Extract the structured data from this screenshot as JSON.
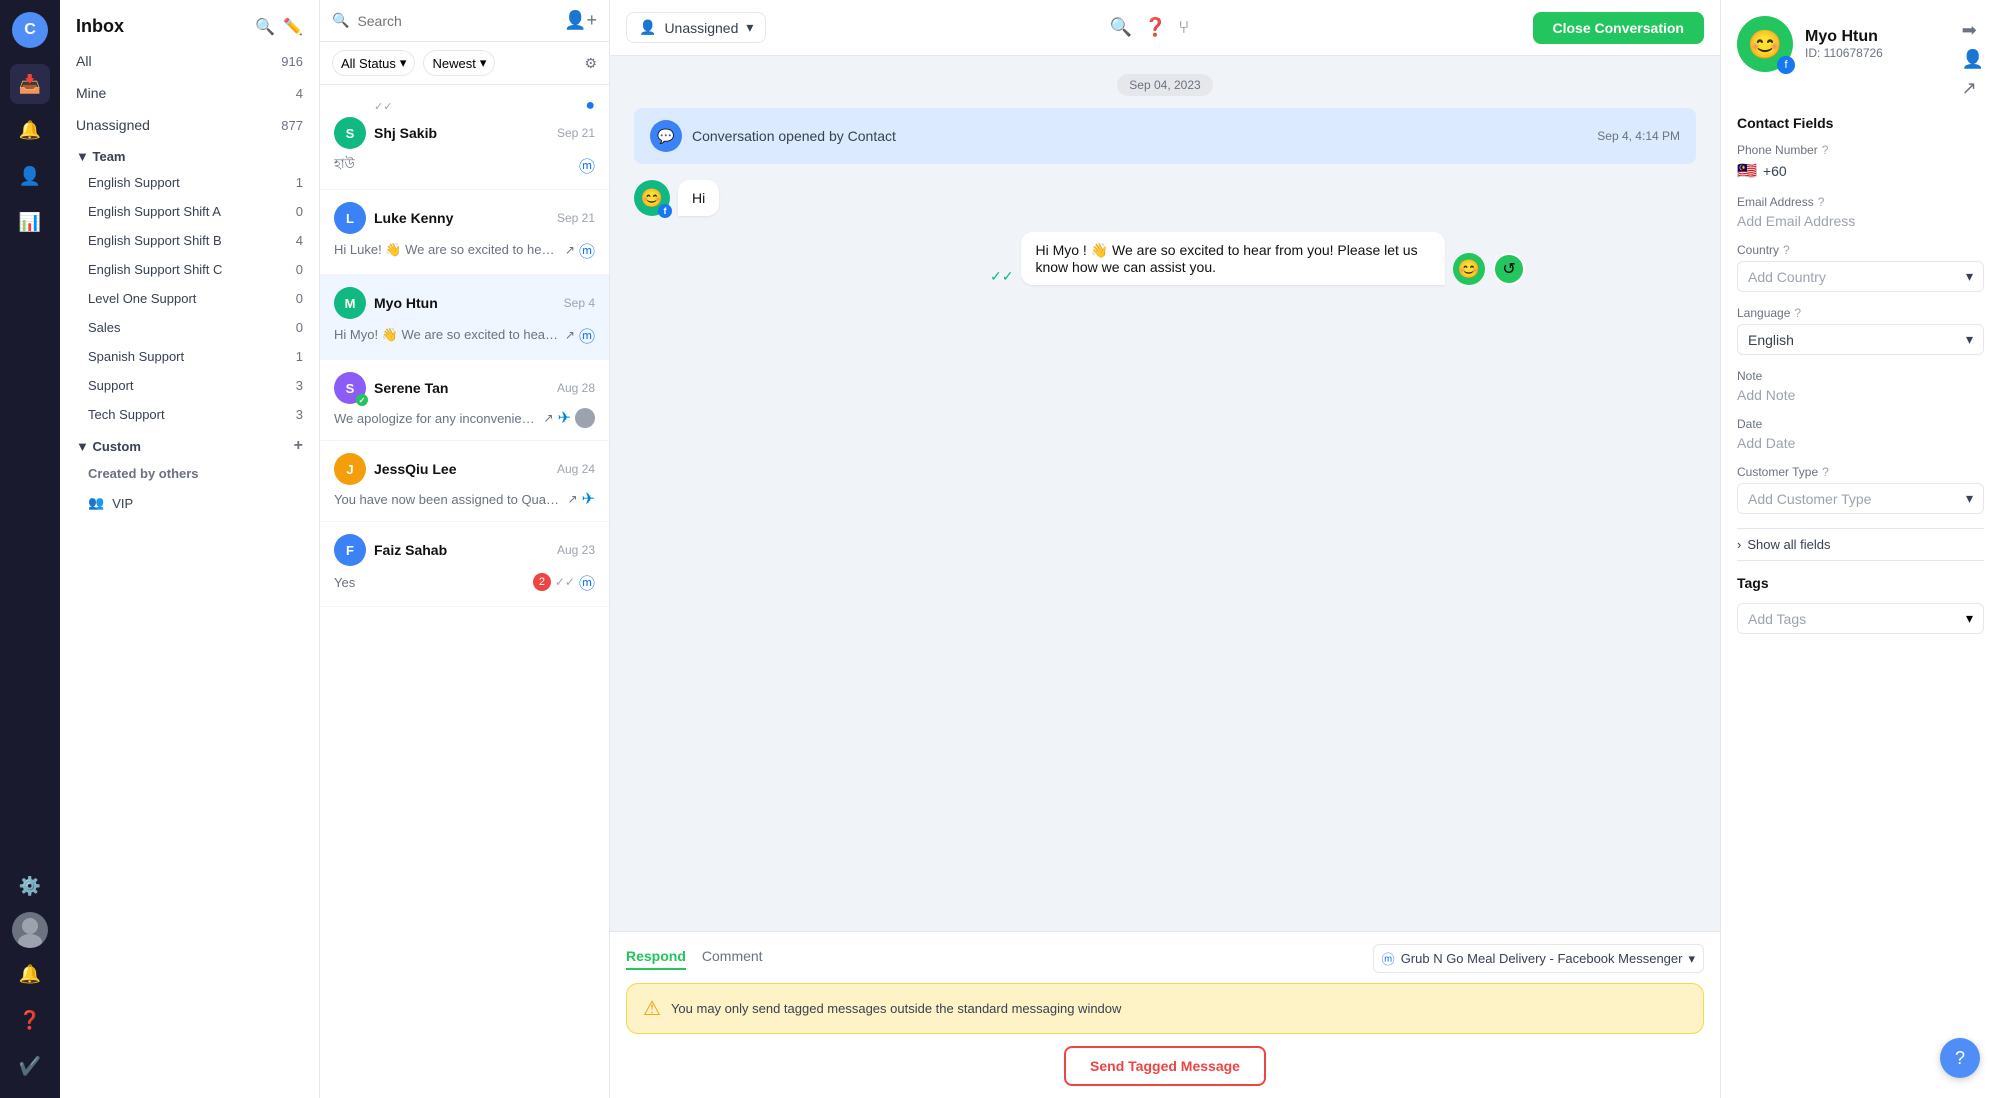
{
  "app": {
    "logo": "C",
    "title": "Inbox"
  },
  "nav": {
    "items": [
      {
        "id": "inbox",
        "icon": "📥",
        "active": true
      },
      {
        "id": "mentions",
        "icon": "🔔"
      },
      {
        "id": "contacts",
        "icon": "👤"
      },
      {
        "id": "reports",
        "icon": "📊"
      },
      {
        "id": "settings",
        "icon": "⚙️"
      }
    ]
  },
  "sidebar": {
    "header": "Inbox",
    "items": [
      {
        "label": "All",
        "count": "916"
      },
      {
        "label": "Mine",
        "count": "4"
      },
      {
        "label": "Unassigned",
        "count": "877"
      }
    ],
    "team_label": "Team",
    "team_items": [
      {
        "label": "English Support",
        "count": "1"
      },
      {
        "label": "English Support Shift A",
        "count": "0"
      },
      {
        "label": "English Support Shift B",
        "count": "4"
      },
      {
        "label": "English Support Shift C",
        "count": "0"
      },
      {
        "label": "Level One Support",
        "count": "0"
      },
      {
        "label": "Sales",
        "count": "0"
      },
      {
        "label": "Spanish Support",
        "count": "1"
      },
      {
        "label": "Support",
        "count": "3"
      },
      {
        "label": "Tech Support",
        "count": "3"
      }
    ],
    "custom_label": "Custom",
    "custom_others_label": "Created by others",
    "custom_items": [
      {
        "label": "VIP",
        "icon": "👥"
      }
    ]
  },
  "conv_list": {
    "search_placeholder": "Search",
    "filter_status": "All Status",
    "filter_sort": "Newest",
    "conversations": [
      {
        "id": 1,
        "sender": "Shj Sakib",
        "avatar_color": "green",
        "avatar_text": "S",
        "date": "Sep 21",
        "preview": "হাউ",
        "channel": "fb",
        "has_tick": true
      },
      {
        "id": 2,
        "sender": "Luke Kenny",
        "avatar_color": "blue",
        "avatar_text": "L",
        "date": "Sep 21",
        "preview": "Hi Luke! 👋 We are so excited to hear from you! Please let us kno...",
        "channel": "fb",
        "has_tick": false,
        "has_arrow": true
      },
      {
        "id": 3,
        "sender": "Myo Htun",
        "avatar_color": "green",
        "avatar_text": "M",
        "date": "Sep 4",
        "preview": "Hi Myo! 👋 We are so excited to hear from you! Please let us kno...",
        "channel": "fb",
        "has_arrow": true,
        "active": true
      },
      {
        "id": 4,
        "sender": "Serene Tan",
        "avatar_color": "purple",
        "avatar_text": "S",
        "date": "Aug 28",
        "preview": "We apologize for any inconvenience you may have...",
        "channel": "telegram",
        "has_tick": true,
        "has_resolved": true
      },
      {
        "id": 5,
        "sender": "JessQiu Lee",
        "avatar_color": "orange",
        "avatar_text": "J",
        "date": "Aug 24",
        "preview": "You have now been assigned to Quan on the support team.",
        "channel": "telegram",
        "has_arrow": true
      },
      {
        "id": 6,
        "sender": "Faiz Sahab",
        "avatar_color": "blue",
        "avatar_text": "F",
        "date": "Aug 23",
        "preview": "Yes",
        "channel": "fb",
        "has_tick": true,
        "badge_count": "2"
      }
    ]
  },
  "chat": {
    "assignee": "Unassigned",
    "close_btn": "Close Conversation",
    "date_separator": "Sep 04, 2023",
    "system_msg": "Conversation opened by Contact",
    "system_time": "Sep 4, 4:14 PM",
    "messages": [
      {
        "type": "incoming",
        "text": "Hi",
        "avatar_emoji": "😊"
      },
      {
        "type": "outgoing",
        "text": "Hi Myo ! 👋 We are so excited to hear from you! Please let us know how we can assist you."
      }
    ],
    "footer": {
      "tab_respond": "Respond",
      "tab_comment": "Comment",
      "channel": "Grub N Go Meal Delivery - Facebook Messenger",
      "warning": "You may only send tagged messages outside the standard messaging window",
      "send_btn": "Send Tagged Message"
    }
  },
  "contact": {
    "name": "Myo Htun",
    "id": "ID: 110678726",
    "section_label": "Contact Fields",
    "phone_label": "Phone Number",
    "phone_value": "+60",
    "phone_flag": "🇲🇾",
    "email_label": "Email Address",
    "email_placeholder": "Add Email Address",
    "country_label": "Country",
    "country_placeholder": "Add Country",
    "language_label": "Language",
    "language_value": "English",
    "note_label": "Note",
    "note_placeholder": "Add Note",
    "date_label": "Date",
    "date_placeholder": "Add Date",
    "customer_type_label": "Customer Type",
    "customer_type_placeholder": "Add Customer Type",
    "show_all_label": "Show all fields",
    "tags_label": "Tags",
    "tags_placeholder": "Add Tags"
  }
}
